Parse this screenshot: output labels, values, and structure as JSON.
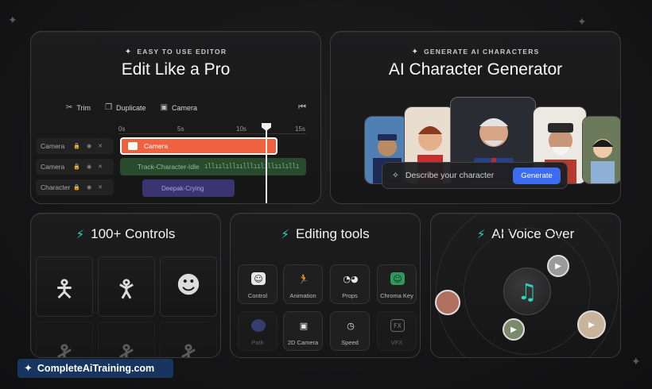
{
  "editor_card": {
    "kicker": "EASY TO USE EDITOR",
    "title": "Edit Like a Pro",
    "toolbar": [
      {
        "label": "Trim",
        "icon": "scissors-icon"
      },
      {
        "label": "Duplicate",
        "icon": "duplicate-icon"
      },
      {
        "label": "Camera",
        "icon": "camera-icon"
      }
    ],
    "ruler": [
      "0s",
      "5s",
      "10s",
      "15s"
    ],
    "tracks": [
      {
        "label": "Camera"
      },
      {
        "label": "Camera"
      },
      {
        "label": "Character"
      }
    ],
    "clips": {
      "camera": "Camera",
      "audio": "Track-Character-Idle",
      "animation": "Deepak-Crying"
    }
  },
  "characters_card": {
    "kicker": "GENERATE AI CHARACTERS",
    "title": "AI Character Generator",
    "prompt_placeholder": "Describe your character",
    "generate_label": "Generate"
  },
  "controls_card": {
    "title": "100+ Controls"
  },
  "editing_tools_card": {
    "title": "Editing tools",
    "tools": [
      {
        "label": "Control",
        "icon": "face-icon"
      },
      {
        "label": "Animation",
        "icon": "running-icon"
      },
      {
        "label": "Props",
        "icon": "glasses-icon"
      },
      {
        "label": "Chroma Key",
        "icon": "chroma-key-icon"
      },
      {
        "label": "Path",
        "icon": "path-icon"
      },
      {
        "label": "2D Camera",
        "icon": "camera-icon"
      },
      {
        "label": "Speed",
        "icon": "speedometer-icon"
      },
      {
        "label": "VFX",
        "icon": "fx-icon"
      }
    ]
  },
  "voice_card": {
    "title": "AI Voice Over"
  },
  "watermark": {
    "text": "CompleteAiTraining.com"
  },
  "colors": {
    "accent_teal": "#2dd4bf",
    "clip_orange": "#f0613f",
    "generate_blue": "#3c6df0",
    "watermark_bg": "#17355f"
  }
}
